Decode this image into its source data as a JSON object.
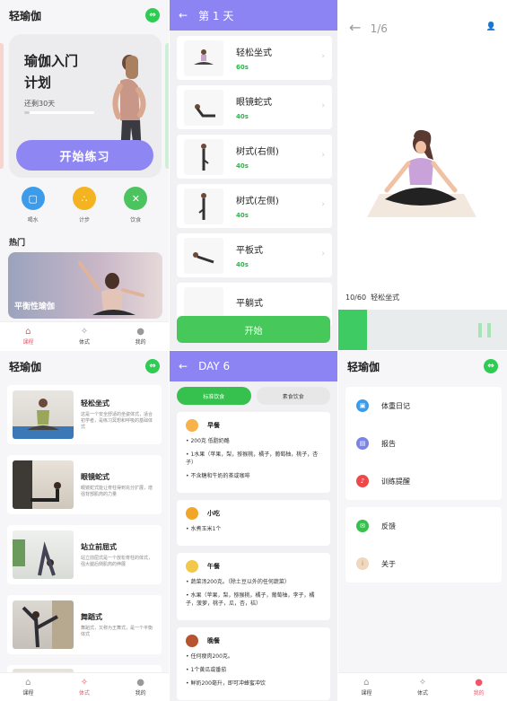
{
  "app": {
    "title": "轻瑜伽"
  },
  "home": {
    "plan_title_1": "瑜伽入门",
    "plan_title_2": "计划",
    "plan_remaining": "还剩30天",
    "plan_progress": 0.08,
    "start_label": "开始练习",
    "quick": [
      {
        "label": "喝水",
        "icon": "water-icon",
        "color": "#3d9ce9"
      },
      {
        "label": "计步",
        "icon": "footprints-icon",
        "color": "#f4b321"
      },
      {
        "label": "饮食",
        "icon": "utensils-icon",
        "color": "#4bc45f"
      }
    ],
    "hot_label": "热门",
    "hot_card": "平衡性瑜伽"
  },
  "tabs": {
    "courses": "课程",
    "poses": "体式",
    "mine": "我的"
  },
  "day1": {
    "title": "第 1 天",
    "items": [
      {
        "name": "轻松坐式",
        "dur": "60s"
      },
      {
        "name": "眼镜蛇式",
        "dur": "40s"
      },
      {
        "name": "树式(右侧)",
        "dur": "40s"
      },
      {
        "name": "树式(左侧)",
        "dur": "40s"
      },
      {
        "name": "平板式",
        "dur": "40s"
      },
      {
        "name": "平躺式",
        "dur": ""
      }
    ],
    "start": "开始"
  },
  "player": {
    "page": "1/6",
    "timer": "10/60",
    "pose": "轻松坐式",
    "progress": 0.17
  },
  "library": {
    "items": [
      {
        "name": "轻松坐式",
        "desc": "这是一个安全舒适的坐姿体式，适合初学者，是练习冥想和呼吸的基础体式"
      },
      {
        "name": "眼镜蛇式",
        "desc": "眼镜蛇式能让脊柱得到充分扩展，增强背部肌肉的力量"
      },
      {
        "name": "站立前屈式",
        "desc": "站立前屈式是一个放松脊柱的体式，强大腿后侧肌肉的伸展"
      },
      {
        "name": "舞蹈式",
        "desc": "舞蹈式，又称为王舞式，是一个平衡体式"
      },
      {
        "name": "",
        "desc": ""
      }
    ]
  },
  "diet": {
    "title": "DAY 6",
    "tab_standard": "标准饮食",
    "tab_vegan": "素食饮食",
    "meals": [
      {
        "name": "早餐",
        "color": "#f7b24a",
        "lines": [
          "• 200克 低脂奶酪",
          "• 1水果（苹果，梨，猕猴桃，橘子，葡萄柚，桃子，杏子）",
          "• 不含糖和牛奶的茶或咖啡"
        ]
      },
      {
        "name": "小吃",
        "color": "#f1a629",
        "lines": [
          "• 水煮玉米1个"
        ]
      },
      {
        "name": "午餐",
        "color": "#f2c84b",
        "lines": [
          "• 蔬菜汤200克。（除土豆以外的任何蔬菜）",
          "• 水果（苹果，梨，猕猴桃，橘子，葡萄柚，李子，橘子，菠萝，桃子，瓜，杏，桔）"
        ]
      },
      {
        "name": "晚餐",
        "color": "#b5542e",
        "lines": [
          "• 任何瘦肉200克。",
          "• 1个黄瓜或番茄",
          "• 鲜奶200毫升，即可冲蜂蜜冲饮"
        ]
      }
    ]
  },
  "profile": {
    "group1": [
      {
        "label": "体重日记",
        "icon": "scale-icon",
        "color": "#3d9ce9"
      },
      {
        "label": "报告",
        "icon": "report-icon",
        "color": "#7b84e6"
      },
      {
        "label": "训练提醒",
        "icon": "bell-icon",
        "color": "#ec4a4a"
      }
    ],
    "group2": [
      {
        "label": "反馈",
        "icon": "mail-icon",
        "color": "#36c04e"
      },
      {
        "label": "关于",
        "icon": "info-icon",
        "color": "#efd8bd"
      }
    ]
  }
}
